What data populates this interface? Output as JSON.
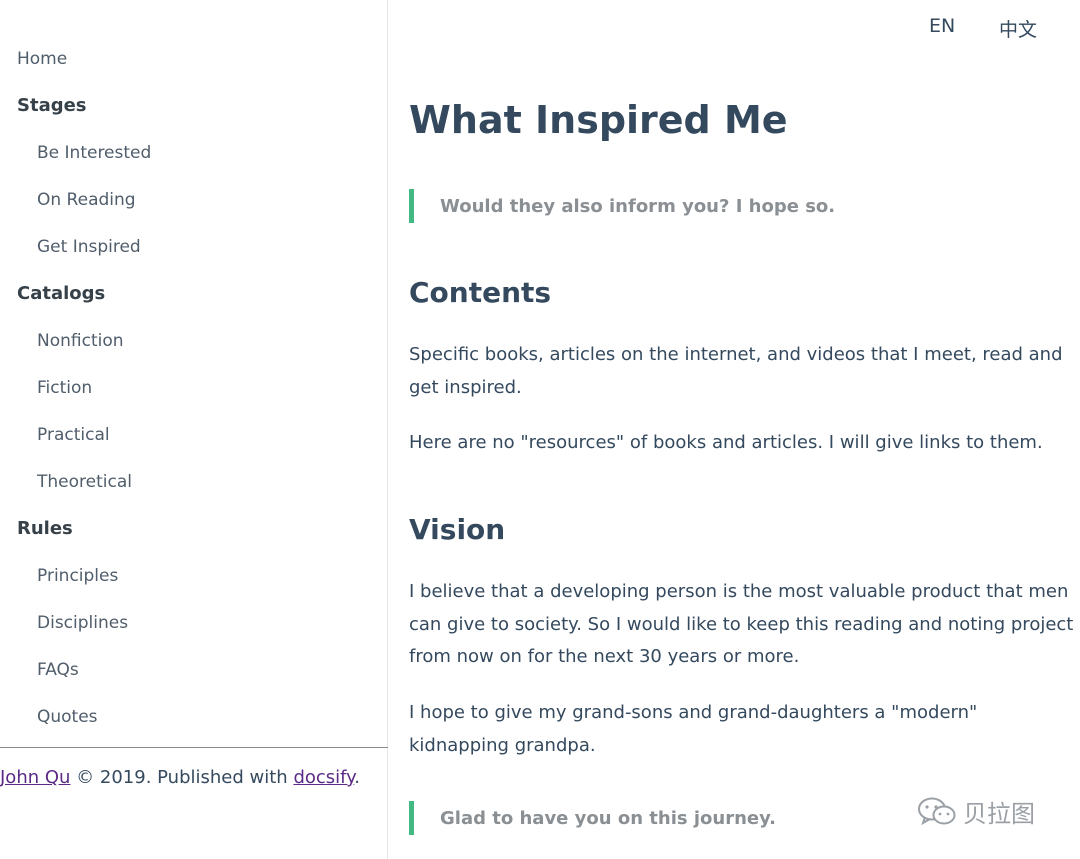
{
  "sidebar": {
    "items": [
      {
        "label": "Home",
        "kind": "link"
      },
      {
        "label": "Stages",
        "kind": "section"
      },
      {
        "label": "Be Interested",
        "kind": "sub"
      },
      {
        "label": "On Reading",
        "kind": "sub"
      },
      {
        "label": "Get Inspired",
        "kind": "sub"
      },
      {
        "label": "Catalogs",
        "kind": "section"
      },
      {
        "label": "Nonfiction",
        "kind": "sub"
      },
      {
        "label": "Fiction",
        "kind": "sub"
      },
      {
        "label": "Practical",
        "kind": "sub"
      },
      {
        "label": "Theoretical",
        "kind": "sub"
      },
      {
        "label": "Rules",
        "kind": "section"
      },
      {
        "label": "Principles",
        "kind": "sub"
      },
      {
        "label": "Disciplines",
        "kind": "sub"
      },
      {
        "label": "FAQs",
        "kind": "sub"
      },
      {
        "label": "Quotes",
        "kind": "sub"
      }
    ]
  },
  "footer": {
    "author": "John Qu",
    "middle": " © 2019. Published with ",
    "tool": "docsify",
    "end": "."
  },
  "lang": {
    "en": "EN",
    "zh": "中文"
  },
  "main": {
    "title": "What Inspired Me",
    "quote1": "Would they also inform you? I hope so.",
    "contents_heading": "Contents",
    "contents_p1": "Specific books, articles on the internet, and videos that I meet, read and get inspired.",
    "contents_p2": "Here are no \"resources\" of books and articles. I will give links to them.",
    "vision_heading": "Vision",
    "vision_p1": "I believe that a developing person is the most valuable product that men can give to society. So I would like to keep this reading and noting project from now on for the next 30 years or more.",
    "vision_p2": "I hope to give my grand-sons and grand-daughters a \"modern\" kidnapping grandpa.",
    "quote2": "Glad to have you on this journey."
  },
  "watermark": {
    "text": "贝拉图",
    "icon": "wechat-icon"
  },
  "colors": {
    "accent": "#42b983",
    "text": "#34495e",
    "link": "#5b2a86",
    "quote_text": "#8a8f94"
  }
}
